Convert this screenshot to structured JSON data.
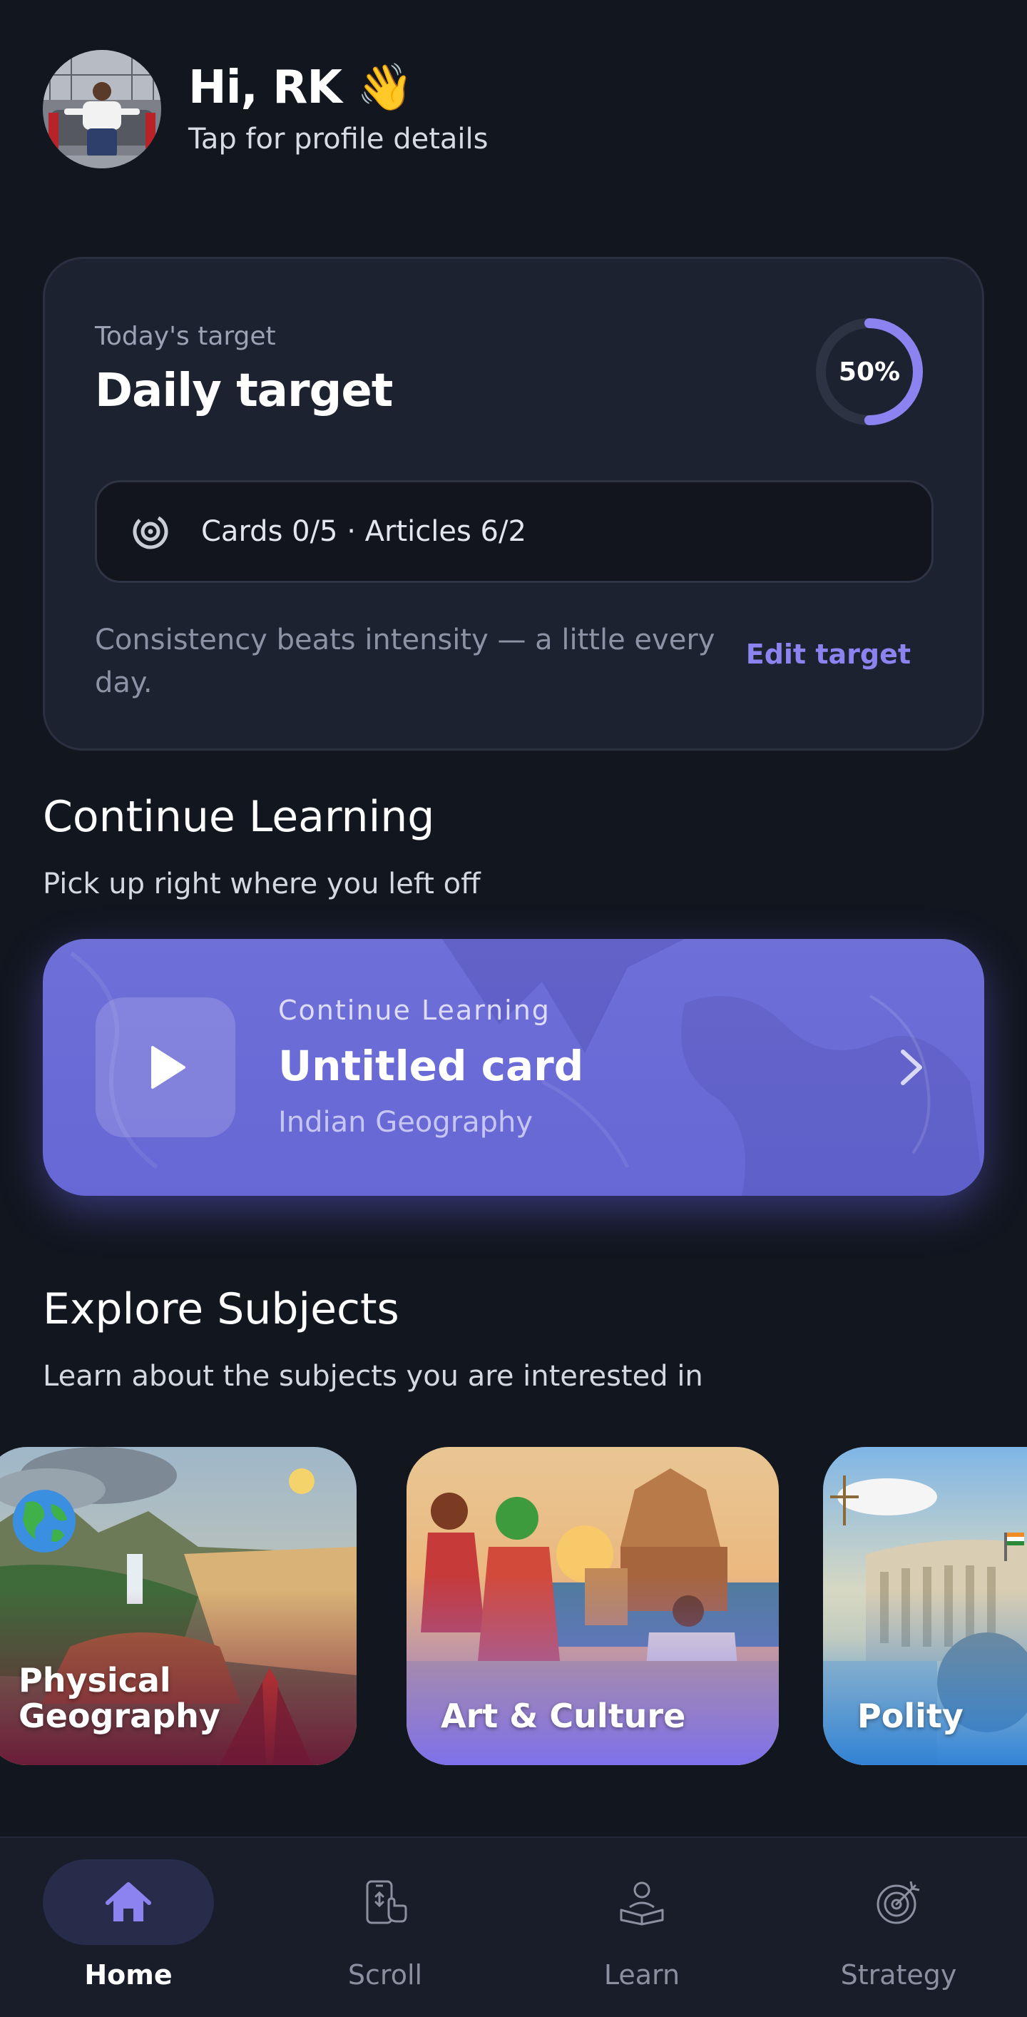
{
  "header": {
    "greeting": "Hi, RK 👋",
    "subtitle": "Tap for profile details"
  },
  "daily_target": {
    "label": "Today's target",
    "title": "Daily target",
    "progress_percent": 50,
    "progress_text": "50%",
    "stats": "Cards 0/5 · Articles 6/2",
    "quote_line1": "Consistency beats intensity — a little every",
    "quote_line2": "day.",
    "edit_label": "Edit target",
    "accent_color": "#8b84f0"
  },
  "continue_section": {
    "title": "Continue Learning",
    "subtitle": "Pick up right where you left off",
    "card": {
      "label": "Continue Learning",
      "title": "Untitled card",
      "subject": "Indian Geography"
    }
  },
  "explore_section": {
    "title": "Explore Subjects",
    "subtitle": "Learn about the subjects you are interested in",
    "subjects": [
      {
        "line1": "Physical",
        "line2": "Geography",
        "icon": "globe-icon"
      },
      {
        "line1": "Art & Culture",
        "line2": ""
      },
      {
        "line1": "Polity",
        "line2": ""
      }
    ]
  },
  "bottom_nav": {
    "items": [
      {
        "label": "Home",
        "icon": "home-icon",
        "active": true
      },
      {
        "label": "Scroll",
        "icon": "phone-swipe-icon",
        "active": false
      },
      {
        "label": "Learn",
        "icon": "reader-icon",
        "active": false
      },
      {
        "label": "Strategy",
        "icon": "target-arrow-icon",
        "active": false
      }
    ]
  }
}
